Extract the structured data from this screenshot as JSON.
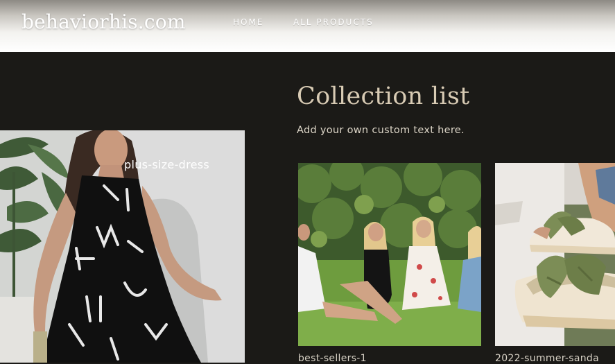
{
  "header": {
    "logo": "behaviorhis.com",
    "nav": [
      {
        "label": "HOME"
      },
      {
        "label": "ALL PRODUCTS"
      }
    ]
  },
  "section": {
    "title": "Collection list",
    "subtitle": "Add your own custom text here."
  },
  "featured": {
    "label": "plus-size-dress"
  },
  "collections": [
    {
      "label": "best-sellers-1"
    },
    {
      "label": "2022-summer-sanda"
    }
  ],
  "colors": {
    "page_background": "#1b1a17",
    "title": "#d8cbb4",
    "text": "#ddd6c8"
  }
}
